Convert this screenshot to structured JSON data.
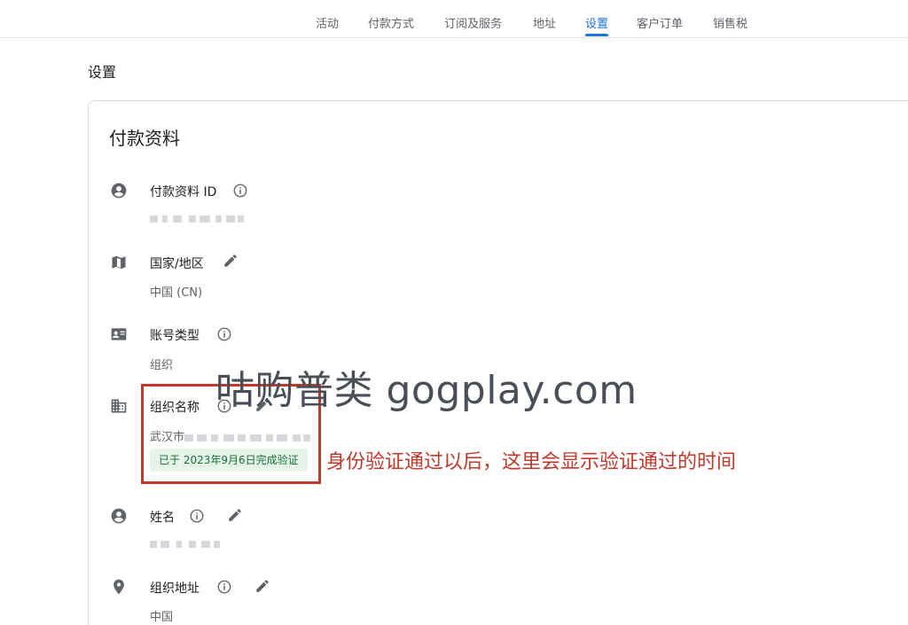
{
  "tabs": [
    {
      "label": "活动",
      "active": false
    },
    {
      "label": "付款方式",
      "active": false
    },
    {
      "label": "订阅及服务",
      "active": false
    },
    {
      "label": "地址",
      "active": false
    },
    {
      "label": "设置",
      "active": true
    },
    {
      "label": "客户订单",
      "active": false
    },
    {
      "label": "销售税",
      "active": false
    }
  ],
  "page_title": "设置",
  "card": {
    "title": "付款资料",
    "rows": [
      {
        "icon": "account-circle-icon",
        "label": "付款资料 ID",
        "value": "",
        "value_blurred": true,
        "has_info": true,
        "has_edit": false
      },
      {
        "icon": "map-icon",
        "label": "国家/地区",
        "value": "中国 (CN)",
        "has_info": false,
        "has_edit": true
      },
      {
        "icon": "contact-card-icon",
        "label": "账号类型",
        "value": "组织",
        "has_info": true,
        "has_edit": false
      },
      {
        "icon": "building-icon",
        "label": "组织名称",
        "value": "武汉市",
        "value_blurred": true,
        "has_info": true,
        "has_edit": true,
        "badge": "已于 2023年9月6日完成验证"
      },
      {
        "icon": "account-circle-icon",
        "label": "姓名",
        "value": "",
        "value_blurred": true,
        "has_info": true,
        "has_edit": true
      },
      {
        "icon": "location-pin-icon",
        "label": "组织地址",
        "value": "中国",
        "has_info": true,
        "has_edit": true
      }
    ]
  },
  "watermark": "咕购普类 gogplay.com",
  "annotation": "身份验证通过以后，这里会显示验证通过的时间",
  "colors": {
    "accent": "#1a73e8",
    "annotation": "#c0392b",
    "verified_bg": "#e6f4ea",
    "verified_text": "#137333"
  }
}
